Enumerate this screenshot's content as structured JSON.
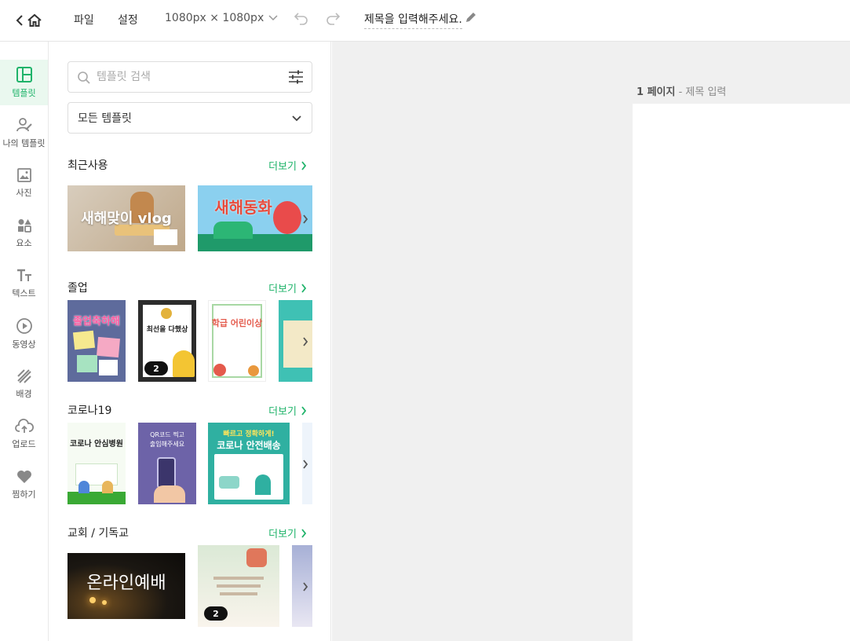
{
  "topbar": {
    "menu_file": "파일",
    "menu_settings": "설정",
    "canvas_size": "1080px × 1080px",
    "document_title": "제목을 입력해주세요."
  },
  "rail": {
    "items": [
      {
        "label": "템플릿",
        "icon": "layout-icon",
        "active": true
      },
      {
        "label": "나의 템플릿",
        "icon": "my-template-icon"
      },
      {
        "label": "사진",
        "icon": "image-icon"
      },
      {
        "label": "요소",
        "icon": "shapes-icon"
      },
      {
        "label": "텍스트",
        "icon": "text-icon"
      },
      {
        "label": "동영상",
        "icon": "play-icon"
      },
      {
        "label": "배경",
        "icon": "background-icon"
      },
      {
        "label": "업로드",
        "icon": "upload-cloud-icon"
      },
      {
        "label": "찜하기",
        "icon": "heart-icon"
      }
    ]
  },
  "panel": {
    "search_placeholder": "템플릿 검색",
    "category_select": "모든 템플릿",
    "more_label": "더보기",
    "sections": [
      {
        "title": "최근사용"
      },
      {
        "title": "졸업"
      },
      {
        "title": "코로나19"
      },
      {
        "title": "교회 / 기독교"
      }
    ],
    "thumb_texts": {
      "vlog": "새해맞이 vlog",
      "fairy": "새해동화",
      "grad1": "졸업축하해",
      "grad2": "최선을 다했상",
      "grad3": "학급 어린이상",
      "covid1": "코로나 안심병원",
      "covid2_a": "QR코드 찍고",
      "covid2_b": "출입해주세요",
      "covid3_a": "빠르고 정확하게!",
      "covid3_b": "코로나 안전배송",
      "church1": "온라인예배"
    },
    "badge_counts": {
      "grad2": "2",
      "church2": "2"
    }
  },
  "canvas": {
    "page_number": "1 페이지",
    "page_title_placeholder": " - 제목 입력"
  }
}
